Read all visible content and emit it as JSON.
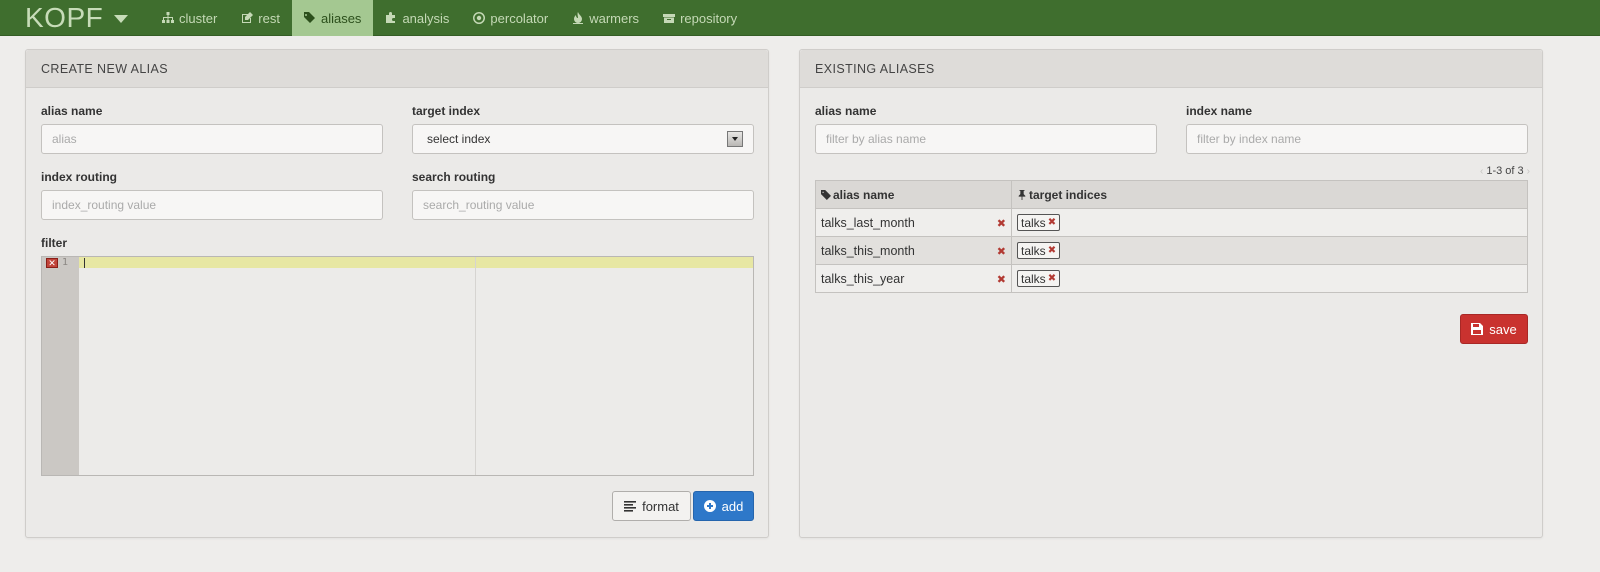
{
  "navbar": {
    "brand": "KOPF",
    "items": [
      {
        "label": "cluster",
        "icon": "sitemap-icon"
      },
      {
        "label": "rest",
        "icon": "edit-icon"
      },
      {
        "label": "aliases",
        "icon": "tags-icon",
        "active": true
      },
      {
        "label": "analysis",
        "icon": "puzzle-icon"
      },
      {
        "label": "percolator",
        "icon": "dot-circle-icon"
      },
      {
        "label": "warmers",
        "icon": "fire-icon"
      },
      {
        "label": "repository",
        "icon": "archive-icon"
      }
    ]
  },
  "create": {
    "title": "CREATE NEW ALIAS",
    "alias_name_label": "alias name",
    "alias_name_placeholder": "alias",
    "target_index_label": "target index",
    "target_index_value": "select index",
    "index_routing_label": "index routing",
    "index_routing_placeholder": "index_routing value",
    "search_routing_label": "search routing",
    "search_routing_placeholder": "search_routing value",
    "filter_label": "filter",
    "editor_line": "1",
    "format_label": "format",
    "add_label": "add"
  },
  "existing": {
    "title": "EXISTING ALIASES",
    "alias_filter_label": "alias name",
    "alias_filter_placeholder": "filter by alias name",
    "index_filter_label": "index name",
    "index_filter_placeholder": "filter by index name",
    "pager": "1-3 of 3",
    "col_alias": "alias name",
    "col_indices": "target indices",
    "rows": [
      {
        "alias": "talks_last_month",
        "index": "talks"
      },
      {
        "alias": "talks_this_month",
        "index": "talks"
      },
      {
        "alias": "talks_this_year",
        "index": "talks"
      }
    ],
    "save_label": "save"
  },
  "colors": {
    "navbar": "#3f6e2e",
    "nav_active": "#a4c891",
    "primary": "#2e78c9",
    "danger": "#c9322f"
  }
}
